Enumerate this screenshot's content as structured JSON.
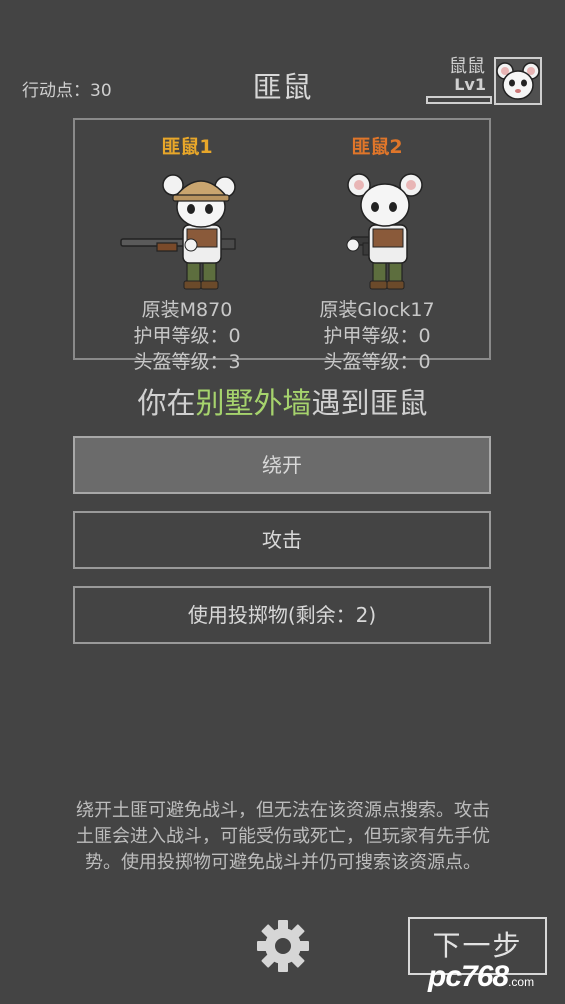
{
  "header": {
    "action_points": "行动点：30",
    "title": "匪鼠",
    "player_name": "鼠鼠",
    "player_level": "Lv1",
    "player_xp_fraction": 0.0
  },
  "enemies": [
    {
      "name": "匪鼠1",
      "name_color": "#e8a72a",
      "weapon": "原装M870",
      "armor": "护甲等级：0",
      "helmet": "头盔等级：3"
    },
    {
      "name": "匪鼠2",
      "name_color": "#e0762a",
      "weapon": "原装Glock17",
      "armor": "护甲等级：0",
      "helmet": "头盔等级：0"
    }
  ],
  "encounter": {
    "prefix": "你在",
    "location": "别墅外墙",
    "suffix": "遇到匪鼠",
    "location_color": "#a6d36d"
  },
  "actions": {
    "bypass": "绕开",
    "attack": "攻击",
    "throw": "使用投掷物(剩余：2)"
  },
  "help_text": "绕开土匪可避免战斗，但无法在该资源点搜索。攻击土匪会进入战斗，可能受伤或死亡，但玩家有先手优势。使用投掷物可避免战斗并仍可搜索该资源点。",
  "footer": {
    "next_label": "下一步",
    "settings_icon": "gear-icon"
  },
  "watermark": {
    "brand": "pc768",
    "domain": ".com"
  }
}
